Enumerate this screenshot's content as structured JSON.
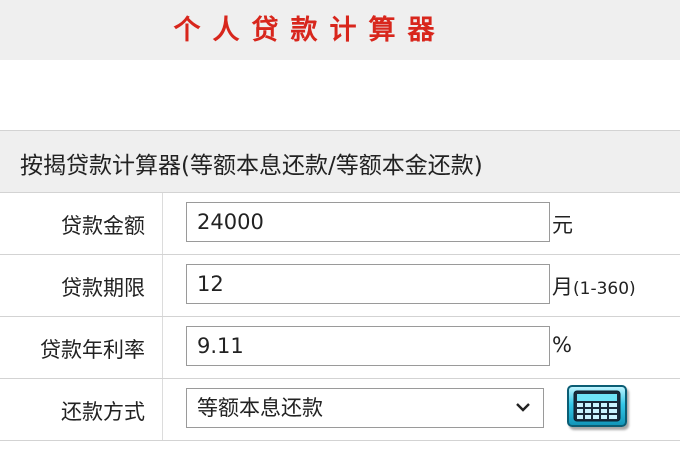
{
  "app": {
    "title": "个人贷款计算器"
  },
  "section": {
    "title": "按揭贷款计算器(等额本息还款/等额本金还款)"
  },
  "form": {
    "amount": {
      "label": "贷款金额",
      "value": "24000",
      "unit": "元"
    },
    "term": {
      "label": "贷款期限",
      "value": "12",
      "unit_main": "月",
      "unit_range": "(1-360)"
    },
    "rate": {
      "label": "贷款年利率",
      "value": "9.11",
      "unit": "%"
    },
    "method": {
      "label": "还款方式",
      "selected": "等额本息还款"
    },
    "calculate_icon": "calculator-icon"
  },
  "colors": {
    "title_red": "#d8261c",
    "band_gray": "#efefef",
    "button_cyan": "#35c8e8"
  }
}
